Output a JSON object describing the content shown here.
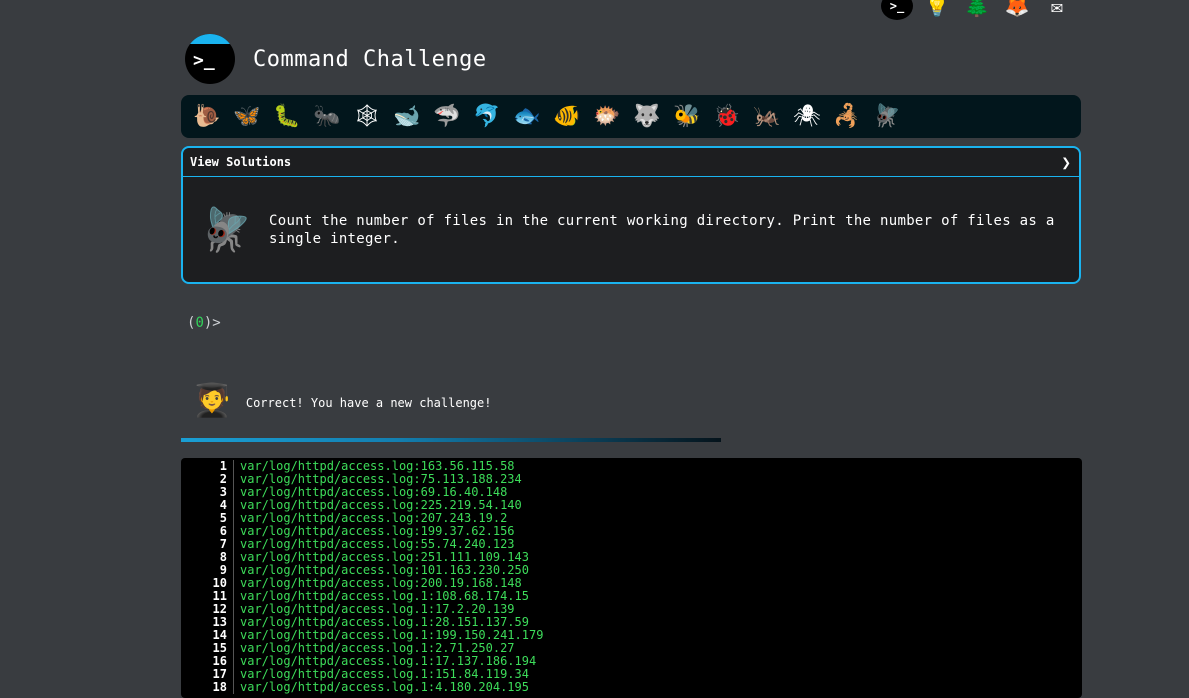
{
  "top_icons": [
    {
      "name": "terminal-icon",
      "glyph": ">_"
    },
    {
      "name": "lightbulb-icon",
      "glyph": "💡"
    },
    {
      "name": "tree-icon",
      "glyph": "🌲"
    },
    {
      "name": "fox-icon",
      "glyph": "🦊"
    },
    {
      "name": "mail-icon",
      "glyph": "✉"
    }
  ],
  "header": {
    "logo_glyph": ">_",
    "title": "Command Challenge"
  },
  "emoji_bar": [
    {
      "name": "snail-icon",
      "glyph": "🐌"
    },
    {
      "name": "butterfly-icon",
      "glyph": "🦋"
    },
    {
      "name": "caterpillar-icon",
      "glyph": "🐛"
    },
    {
      "name": "ant-icon",
      "glyph": "🐜"
    },
    {
      "name": "web-icon",
      "glyph": "🕸"
    },
    {
      "name": "whale-icon",
      "glyph": "🐋"
    },
    {
      "name": "shark-icon",
      "glyph": "🦈"
    },
    {
      "name": "dolphin-icon",
      "glyph": "🐬"
    },
    {
      "name": "fish-icon",
      "glyph": "🐟"
    },
    {
      "name": "tropical-fish-icon",
      "glyph": "🐠"
    },
    {
      "name": "blowfish-icon",
      "glyph": "🐡"
    },
    {
      "name": "wolf-icon",
      "glyph": "🐺"
    },
    {
      "name": "bee-icon",
      "glyph": "🐝"
    },
    {
      "name": "ladybug-icon",
      "glyph": "🐞"
    },
    {
      "name": "cricket-icon",
      "glyph": "🦗"
    },
    {
      "name": "spider-icon",
      "glyph": "🕷"
    },
    {
      "name": "scorpion-icon",
      "glyph": "🦂"
    },
    {
      "name": "fly-icon",
      "glyph": "🪰"
    }
  ],
  "panel": {
    "header_label": "View Solutions",
    "chevron": "❯",
    "fly_glyph": "🪰",
    "challenge": "Count the number of files in the current working directory. Print the number of files as a single integer."
  },
  "prompt": {
    "open": "(",
    "count": "0",
    "close": ")>"
  },
  "feedback": {
    "avatar_glyph": "🧑‍🎓",
    "message": "Correct! You have a new challenge!"
  },
  "colors": {
    "accent": "#1ab3ef",
    "terminal_text": "#3ddc5a",
    "background": "#393c40"
  },
  "terminal_lines": [
    {
      "n": "1",
      "text": "var/log/httpd/access.log:163.56.115.58"
    },
    {
      "n": "2",
      "text": "var/log/httpd/access.log:75.113.188.234"
    },
    {
      "n": "3",
      "text": "var/log/httpd/access.log:69.16.40.148"
    },
    {
      "n": "4",
      "text": "var/log/httpd/access.log:225.219.54.140"
    },
    {
      "n": "5",
      "text": "var/log/httpd/access.log:207.243.19.2"
    },
    {
      "n": "6",
      "text": "var/log/httpd/access.log:199.37.62.156"
    },
    {
      "n": "7",
      "text": "var/log/httpd/access.log:55.74.240.123"
    },
    {
      "n": "8",
      "text": "var/log/httpd/access.log:251.111.109.143"
    },
    {
      "n": "9",
      "text": "var/log/httpd/access.log:101.163.230.250"
    },
    {
      "n": "10",
      "text": "var/log/httpd/access.log:200.19.168.148"
    },
    {
      "n": "11",
      "text": "var/log/httpd/access.log.1:108.68.174.15"
    },
    {
      "n": "12",
      "text": "var/log/httpd/access.log.1:17.2.20.139"
    },
    {
      "n": "13",
      "text": "var/log/httpd/access.log.1:28.151.137.59"
    },
    {
      "n": "14",
      "text": "var/log/httpd/access.log.1:199.150.241.179"
    },
    {
      "n": "15",
      "text": "var/log/httpd/access.log.1:2.71.250.27"
    },
    {
      "n": "16",
      "text": "var/log/httpd/access.log.1:17.137.186.194"
    },
    {
      "n": "17",
      "text": "var/log/httpd/access.log.1:151.84.119.34"
    },
    {
      "n": "18",
      "text": "var/log/httpd/access.log.1:4.180.204.195"
    }
  ]
}
